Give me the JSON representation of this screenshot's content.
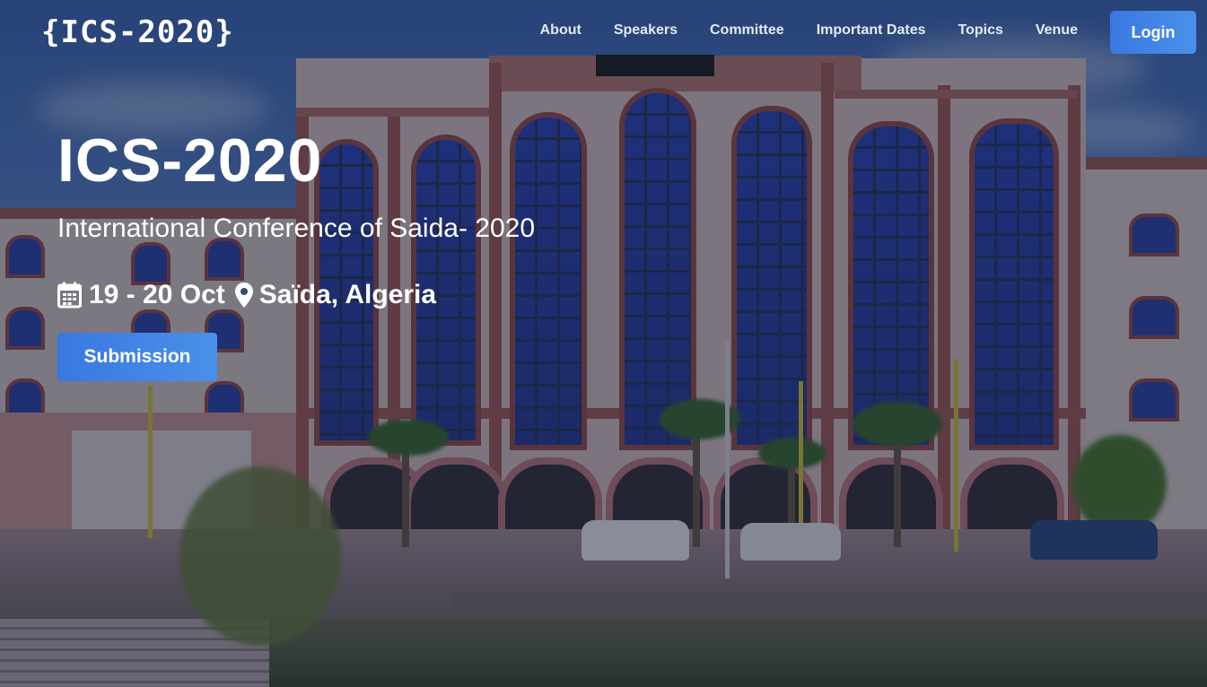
{
  "header": {
    "logo": "{ICS-2020}",
    "nav": [
      "About",
      "Speakers",
      "Committee",
      "Important Dates",
      "Topics",
      "Venue"
    ],
    "login_label": "Login"
  },
  "hero": {
    "title": "ICS-2020",
    "subtitle": "International Conference of Saida- 2020",
    "date": "19 - 20 Oct",
    "location": "Saïda, Algeria",
    "submit_label": "Submission",
    "background": "university-building-photo"
  },
  "colors": {
    "accent": "#3a78e0",
    "overlay": "#0c1630"
  },
  "icons": {
    "date": "calendar-icon",
    "location": "map-pin-icon"
  }
}
